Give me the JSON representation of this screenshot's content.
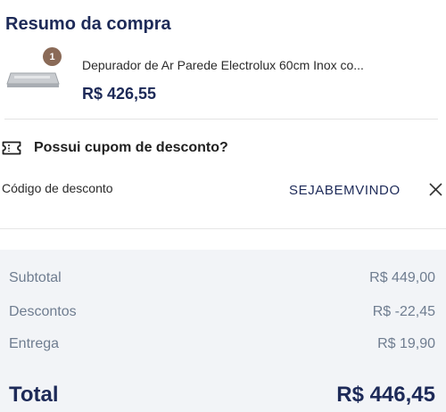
{
  "summary_title": "Resumo da compra",
  "product": {
    "quantity": "1",
    "name": "Depurador de Ar Parede Electrolux 60cm Inox co...",
    "price": "R$ 426,55"
  },
  "coupon": {
    "question": "Possui cupom de desconto?",
    "code_label": "Código de desconto",
    "code_value": "SEJABEMVINDO"
  },
  "totals": {
    "subtotal_label": "Subtotal",
    "subtotal_value": "R$ 449,00",
    "discount_label": "Descontos",
    "discount_value": "R$ -22,45",
    "delivery_label": "Entrega",
    "delivery_value": "R$ 19,90",
    "total_label": "Total",
    "total_value": "R$ 446,45"
  },
  "colors": {
    "navy": "#1d2a58",
    "badge": "#8a6a57",
    "muted": "#6f7d90",
    "summary_bg": "#f2f4f7"
  },
  "icons": [
    "coupon-ticket-icon",
    "close-icon"
  ]
}
